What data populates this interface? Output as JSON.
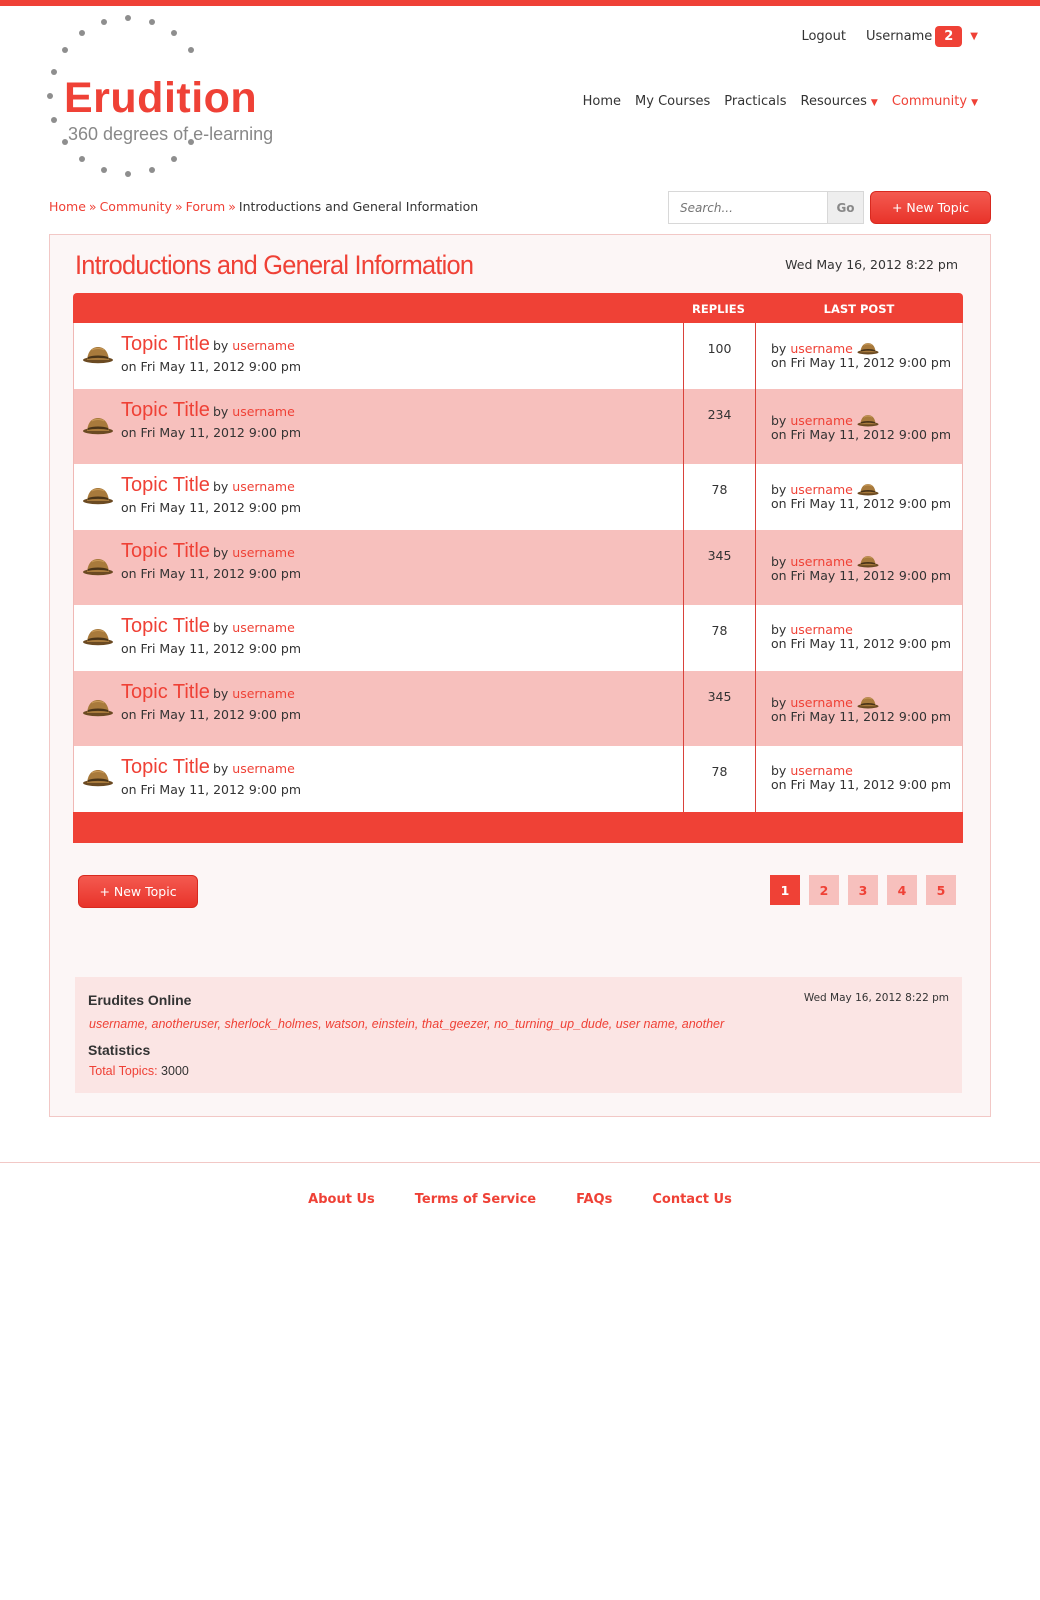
{
  "brand": {
    "name": "Erudition",
    "tagline": "360 degrees of e-learning",
    "accent_color": "#ef4136"
  },
  "user": {
    "logout_label": "Logout",
    "username": "Username",
    "notification_count": "2"
  },
  "nav": {
    "home": "Home",
    "my_courses": "My Courses",
    "practicals": "Practicals",
    "resources": "Resources",
    "community": "Community"
  },
  "breadcrumb": {
    "home": "Home",
    "community": "Community",
    "forum": "Forum",
    "current": "Introductions and General Information",
    "separator": "»"
  },
  "search": {
    "placeholder": "Search...",
    "go_label": "Go"
  },
  "new_topic_label": "+ New Topic",
  "forum": {
    "title": "Introductions and General Information",
    "date": "Wed May 16, 2012 8:22 pm",
    "columns": {
      "replies": "REPLIES",
      "last_post": "LAST POST"
    },
    "topics": [
      {
        "title": "Topic Title",
        "by": "by",
        "author": "username",
        "date": "on Fri May 11, 2012 9:00 pm",
        "replies": "100",
        "last_by": "by",
        "last_user": "username",
        "last_icon": "detective-hat-icon",
        "last_date": "on Fri May 11, 2012 9:00 pm"
      },
      {
        "title": "Topic Title",
        "by": "by",
        "author": "username",
        "date": "on Fri May 11, 2012 9:00 pm",
        "replies": "234",
        "last_by": "by",
        "last_user": "username",
        "last_icon": "detective-hat-icon",
        "last_date": "on Fri May 11, 2012 9:00 pm"
      },
      {
        "title": "Topic Title",
        "by": "by",
        "author": "username",
        "date": "on Fri May 11, 2012 9:00 pm",
        "replies": "78",
        "last_by": "by",
        "last_user": "username",
        "last_icon": "detective-hat-icon",
        "last_date": "on Fri May 11, 2012 9:00 pm"
      },
      {
        "title": "Topic Title",
        "by": "by",
        "author": "username",
        "date": "on Fri May 11, 2012 9:00 pm",
        "replies": "345",
        "last_by": "by",
        "last_user": "username",
        "last_icon": "detective-hat-icon",
        "last_date": "on Fri May 11, 2012 9:00 pm"
      },
      {
        "title": "Topic Title",
        "by": "by",
        "author": "username",
        "date": "on Fri May 11, 2012 9:00 pm",
        "replies": "78",
        "last_by": "by",
        "last_user": "username",
        "last_icon": "",
        "last_date": "on Fri May 11, 2012 9:00 pm"
      },
      {
        "title": "Topic Title",
        "by": "by",
        "author": "username",
        "date": "on Fri May 11, 2012 9:00 pm",
        "replies": "345",
        "last_by": "by",
        "last_user": "username",
        "last_icon": "detective-hat-icon",
        "last_date": "on Fri May 11, 2012 9:00 pm"
      },
      {
        "title": "Topic Title",
        "by": "by",
        "author": "username",
        "date": "on Fri May 11, 2012 9:00 pm",
        "replies": "78",
        "last_by": "by",
        "last_user": "username",
        "last_icon": "",
        "last_date": "on Fri May 11, 2012 9:00 pm"
      }
    ]
  },
  "pagination": {
    "pages": [
      "1",
      "2",
      "3",
      "4",
      "5"
    ],
    "current": "1"
  },
  "online": {
    "title": "Erudites Online",
    "date": "Wed May 16, 2012 8:22 pm",
    "users": "username, anotheruser, sherlock_holmes, watson, einstein, that_geezer, no_turning_up_dude, user name, another",
    "stats_title": "Statistics",
    "total_topics_label": "Total Topics:",
    "total_topics_value": "3000"
  },
  "footer": {
    "about": "About Us",
    "terms": "Terms of Service",
    "faqs": "FAQs",
    "contact": "Contact Us"
  }
}
